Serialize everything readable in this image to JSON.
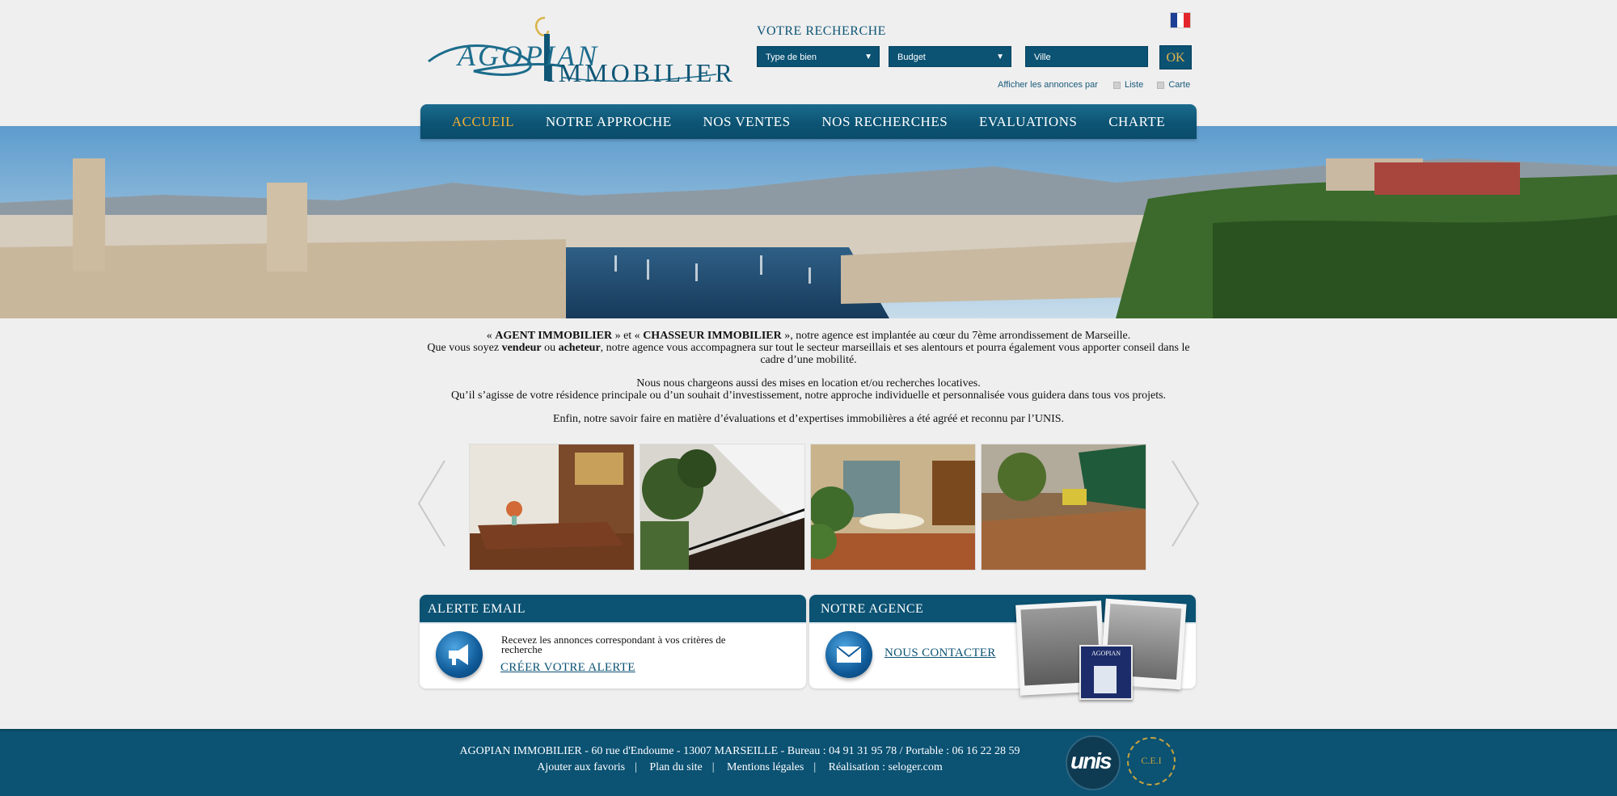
{
  "header": {
    "logo_top": "AGOPIAN",
    "logo_bottom": "IMMOBILIER",
    "search_title": "VOTRE RECHERCHE",
    "type_select": "Type de bien",
    "budget_select": "Budget",
    "city_input": "Ville",
    "ok_label": "OK",
    "display_label": "Afficher les annonces par",
    "list_label": "Liste",
    "map_label": "Carte",
    "flag_colors": [
      "#1d3f95",
      "#ffffff",
      "#e4252c"
    ]
  },
  "nav": {
    "items": [
      "ACCUEIL",
      "NOTRE APPROCHE",
      "NOS VENTES",
      "NOS RECHERCHES",
      "EVALUATIONS",
      "CHARTE"
    ]
  },
  "intro": {
    "l1_open": "« ",
    "l1_b1": "AGENT IMMOBILIER",
    "l1_mid": " » et « ",
    "l1_b2": "CHASSEUR IMMOBILIER",
    "l1_end": " », notre agence est implantée au cœur du 7ème arrondissement de Marseille.",
    "l2_a": "Que vous soyez ",
    "l2_b1": "vendeur",
    "l2_mid": " ou ",
    "l2_b2": "acheteur",
    "l2_end": ", notre agence vous accompagnera sur tout le secteur marseillais et ses alentours et pourra également vous apporter conseil dans le cadre d’une mobilité.",
    "p2_l1": "Nous nous chargeons aussi des  mises en location et/ou recherches locatives.",
    "p2_l2": "Qu’il s’agisse de votre résidence principale ou d’un souhait d’investissement, notre approche individuelle et personnalisée vous guidera dans tous vos projets.",
    "p3": "Enfin, notre savoir faire en matière d’évaluations et d’expertises immobilières a été agréé et reconnu par l’UNIS."
  },
  "alert_box": {
    "title": "ALERTE EMAIL",
    "text": "Recevez les annonces correspondant à vos critères de recherche",
    "link": "CRÉER VOTRE ALERTE"
  },
  "agency_box": {
    "title": "NOTRE AGENCE",
    "link": "NOUS CONTACTER",
    "sign_text": "AGOPIAN"
  },
  "footer": {
    "address": "AGOPIAN IMMOBILIER - 60 rue d'Endoume - 13007 MARSEILLE - Bureau : 04 91 31 95 78 / Portable : 06 16 22 28 59",
    "links": [
      "Ajouter aux favoris",
      "Plan du site",
      "Mentions légales",
      "Réalisation : seloger.com"
    ],
    "unis_logo": "unis",
    "cei_logo": "C.E.I"
  },
  "colors": {
    "brand": "#0b5273",
    "nav_active": "#f2b033"
  }
}
